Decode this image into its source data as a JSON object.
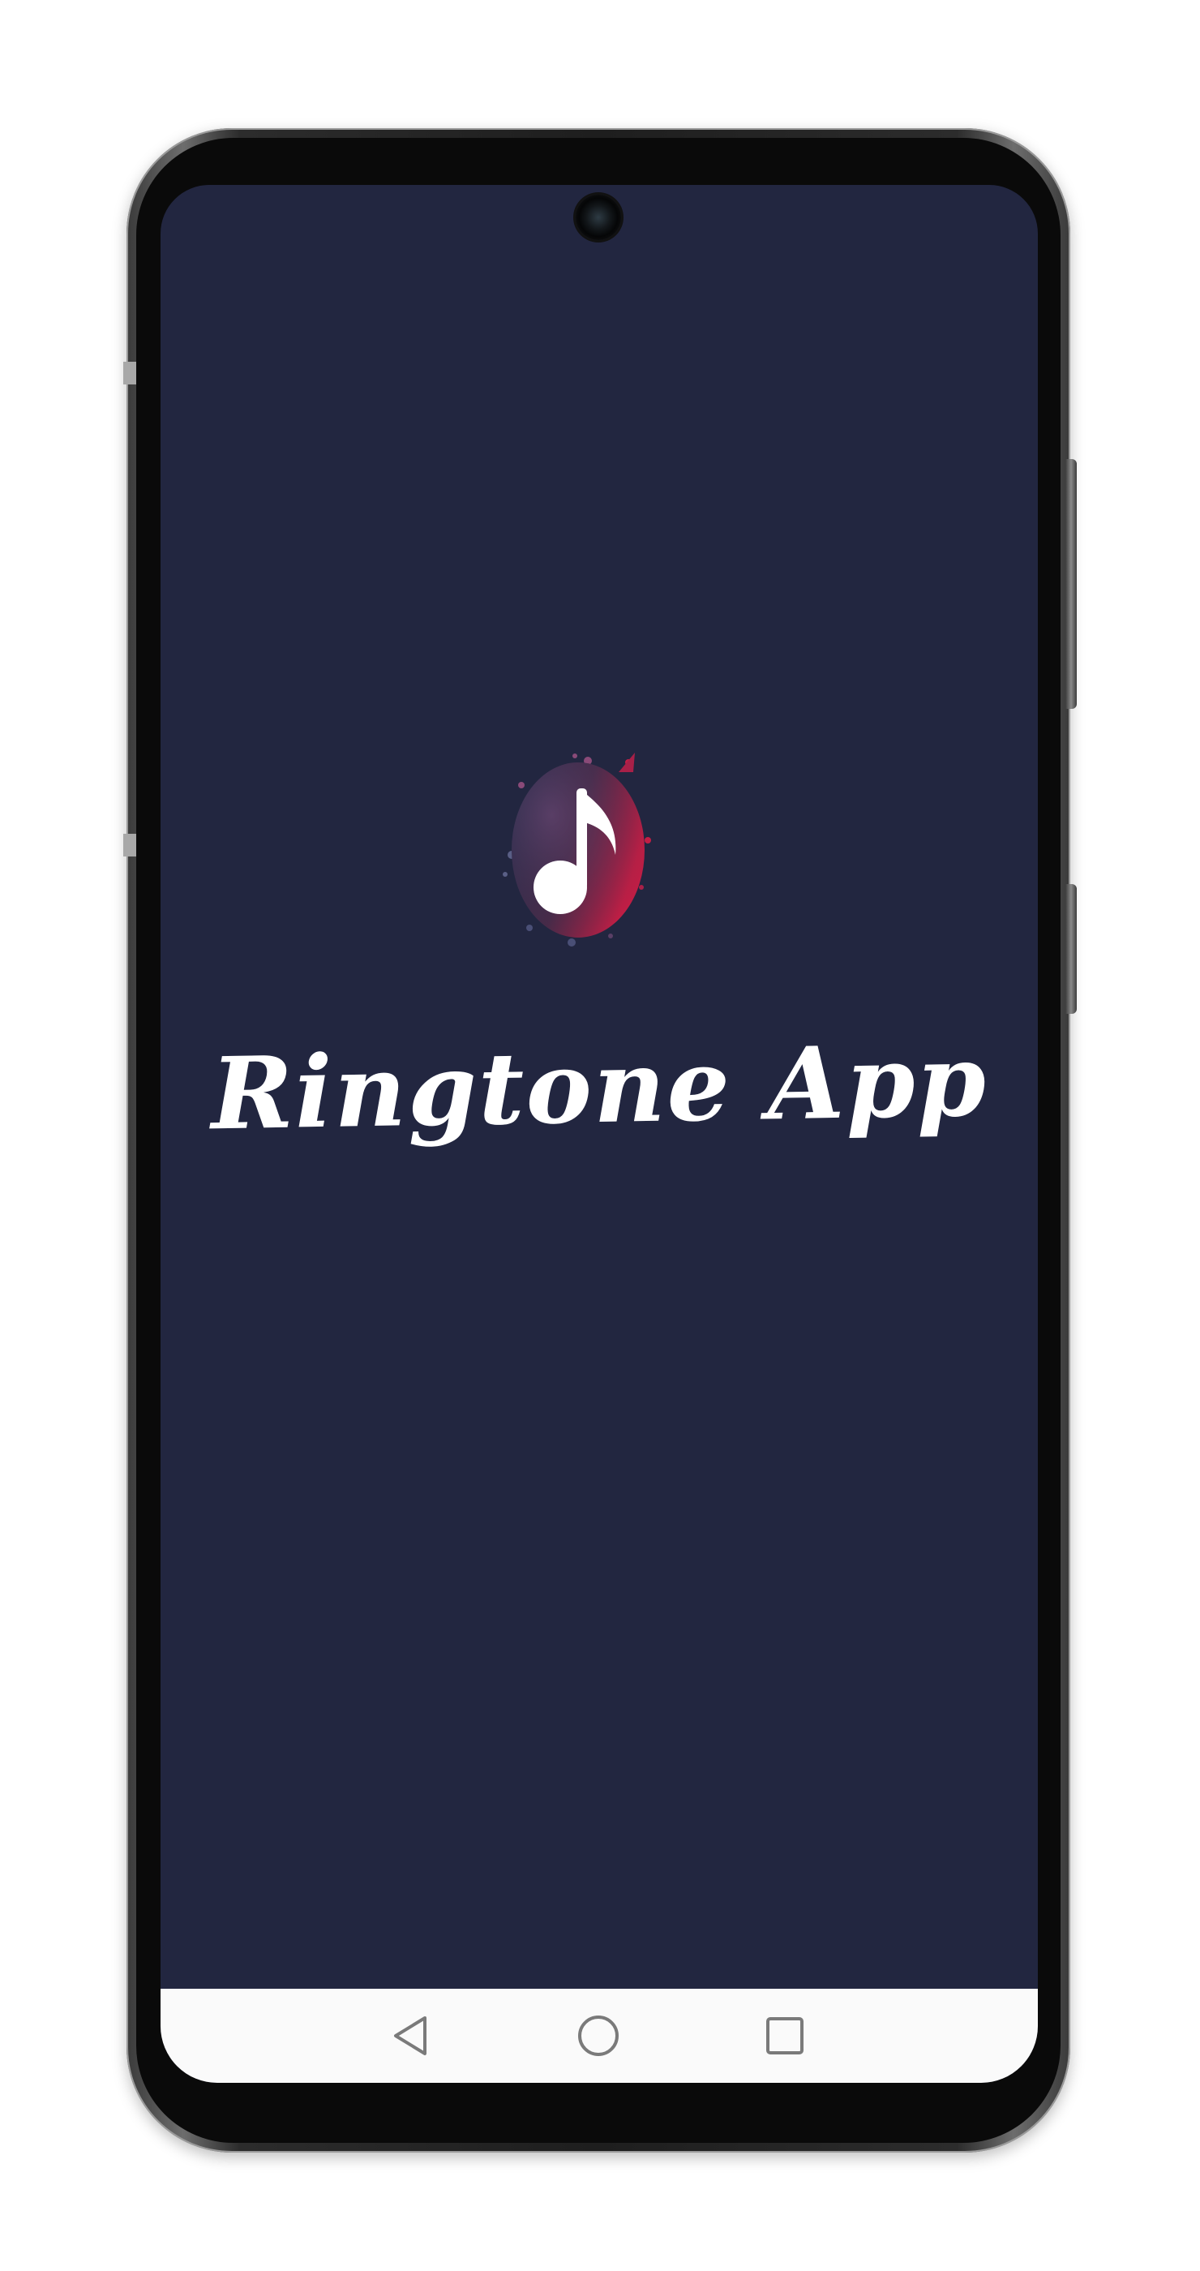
{
  "app": {
    "title": "Ringtone App"
  },
  "colors": {
    "screen_background": "#222640",
    "nav_bar_background": "#fafafa",
    "title_color": "#ffffff",
    "logo_gradient_start": "#2a2f4e",
    "logo_gradient_end": "#c21e45",
    "nav_icon_color": "#7a7a7a"
  },
  "icons": {
    "logo": "music-note-icon",
    "back": "back-triangle-icon",
    "home": "home-circle-icon",
    "recents": "recents-square-icon"
  }
}
